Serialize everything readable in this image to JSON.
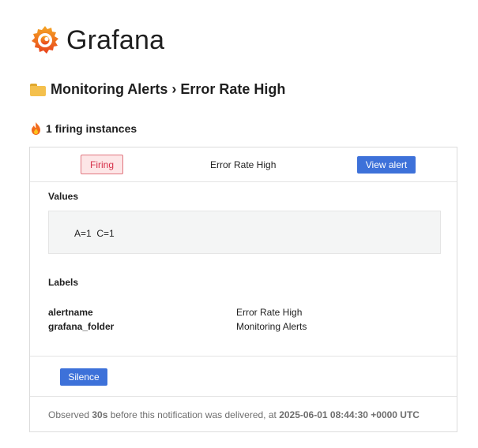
{
  "brand": {
    "name": "Grafana",
    "logo_icon": "grafana-logo-icon",
    "colors": {
      "logo_top": "#f5a623",
      "logo_bottom": "#e8421d"
    }
  },
  "header": {
    "folder_icon": "folder-icon",
    "title": "Monitoring Alerts › Error Rate High"
  },
  "summary": {
    "icon": "fire-icon",
    "text": "1 firing instances"
  },
  "alert": {
    "status": "Firing",
    "name": "Error Rate High",
    "view_button": "View alert",
    "values_heading": "Values",
    "values": "A=1  C=1",
    "labels_heading": "Labels",
    "labels": [
      {
        "key": "alertname",
        "value": "Error Rate High"
      },
      {
        "key": "grafana_folder",
        "value": "Monitoring Alerts"
      }
    ],
    "silence_button": "Silence"
  },
  "footer": {
    "prefix": "Observed ",
    "duration": "30s",
    "middle": " before this notification was delivered, at ",
    "timestamp": "2025-06-01 08:44:30 +0000 UTC"
  },
  "colors": {
    "firing_badge_bg": "#fde6e7",
    "firing_badge_border": "#e0767f",
    "firing_badge_text": "#d6314a",
    "primary_button": "#3d71d9"
  }
}
